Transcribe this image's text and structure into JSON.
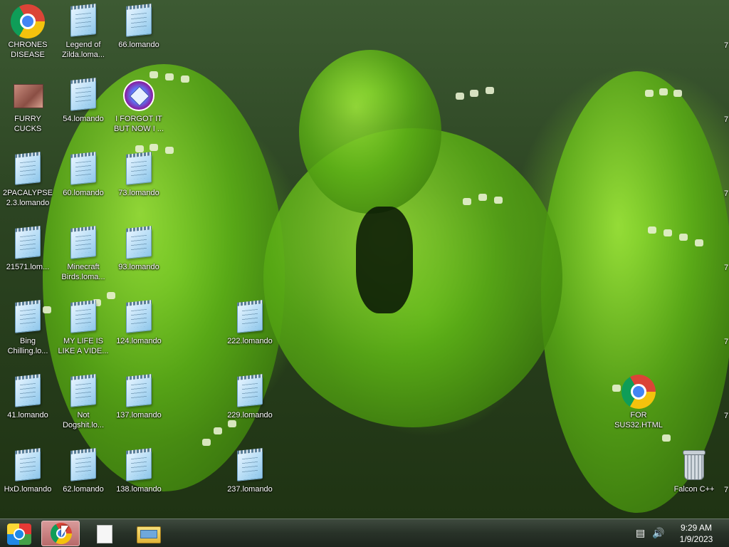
{
  "desktop": {
    "icons": [
      {
        "label": "CHRONES DISEASE",
        "kind": "chrome-icon"
      },
      {
        "label": "Legend of Zilda.loma...",
        "kind": "notepad-icon"
      },
      {
        "label": "66.lomando",
        "kind": "notepad-icon"
      },
      {
        "label": "FURRY CUCKS",
        "kind": "image-thumbnail-icon"
      },
      {
        "label": "54.lomando",
        "kind": "notepad-icon"
      },
      {
        "label": "I FORGOT IT BUT NOW I ...",
        "kind": "gem-icon"
      },
      {
        "label": "2PACALYPSE 2.3.lomando",
        "kind": "notepad-icon"
      },
      {
        "label": "60.lomando",
        "kind": "notepad-icon"
      },
      {
        "label": "73.lomando",
        "kind": "notepad-icon"
      },
      {
        "label": "21571.lom...",
        "kind": "notepad-icon"
      },
      {
        "label": "Minecraft Birds.loma...",
        "kind": "notepad-icon"
      },
      {
        "label": "93.lomando",
        "kind": "notepad-icon"
      },
      {
        "label": "Bing Chilling.lo...",
        "kind": "notepad-icon"
      },
      {
        "label": "MY LIFE IS LIKE A VIDE...",
        "kind": "notepad-icon"
      },
      {
        "label": "124.lomando",
        "kind": "notepad-icon"
      },
      {
        "label": "222.lomando",
        "kind": "notepad-icon"
      },
      {
        "label": "41.lomando",
        "kind": "notepad-icon"
      },
      {
        "label": "Not Dogshit.lo...",
        "kind": "notepad-icon"
      },
      {
        "label": "137.lomando",
        "kind": "notepad-icon"
      },
      {
        "label": "229.lomando",
        "kind": "notepad-icon"
      },
      {
        "label": "FOR SUS32.HTML",
        "kind": "chrome-icon"
      },
      {
        "label": "HxD.lomando",
        "kind": "notepad-icon"
      },
      {
        "label": "62.lomando",
        "kind": "notepad-icon"
      },
      {
        "label": "138.lomando",
        "kind": "notepad-icon"
      },
      {
        "label": "237.lomando",
        "kind": "notepad-icon"
      },
      {
        "label": "Falcon C++",
        "kind": "recycle-bin-icon"
      }
    ],
    "edge_glyph": "7"
  },
  "taskbar": {
    "buttons": [
      {
        "name": "start-orb-icon"
      },
      {
        "name": "chrome-icon",
        "active": true
      },
      {
        "name": "document-icon"
      },
      {
        "name": "file-explorer-icon"
      }
    ],
    "tray": {
      "network_icon": "network-icon",
      "volume_icon": "speaker-icon",
      "time": "9:29 AM",
      "date": "1/9/2023"
    }
  }
}
